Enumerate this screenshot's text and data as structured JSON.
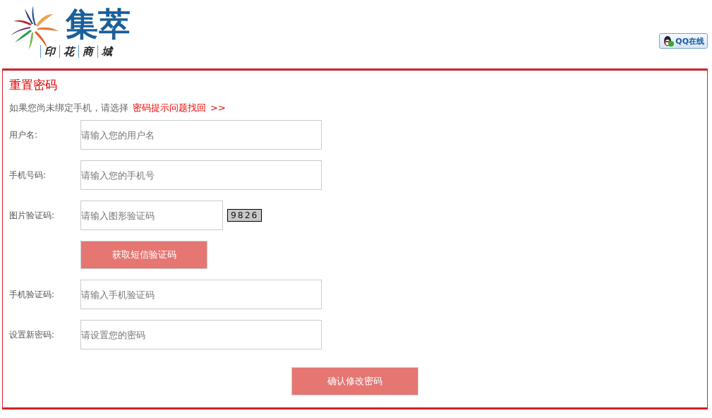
{
  "logo": {
    "title": "集萃",
    "subtitle": [
      "印",
      "花",
      "商",
      "城"
    ]
  },
  "qq_button": "QQ在线",
  "panel": {
    "title": "重置密码",
    "hint": "如果您尚未绑定手机，请选择",
    "hint_link": "密码提示问题找回",
    "hint_arrow": ">>"
  },
  "fields": [
    {
      "kind": "input",
      "label": "用户名:",
      "placeholder": "请输入您的用户名"
    },
    {
      "kind": "input",
      "label": "手机号码:",
      "placeholder": "请输入您的手机号"
    },
    {
      "kind": "captcha",
      "label": "图片验证码:",
      "placeholder": "请输入图形验证码",
      "captcha": "9826"
    },
    {
      "kind": "button",
      "label": "获取短信验证码"
    },
    {
      "kind": "input",
      "label": "手机验证码:",
      "placeholder": "请输入手机验证码"
    },
    {
      "kind": "input",
      "label": "设置新密码:",
      "placeholder": "请设置您的密码"
    }
  ],
  "submit": "确认修改密码"
}
